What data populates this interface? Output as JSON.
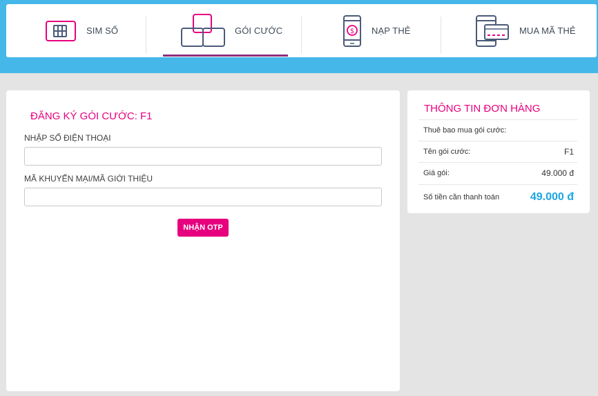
{
  "nav": {
    "items": [
      {
        "label": "SIM SỐ",
        "icon": "sim-card-icon"
      },
      {
        "label": "GÓI CƯỚC",
        "icon": "package-boxes-icon"
      },
      {
        "label": "NẠP THẺ",
        "icon": "phone-topup-icon"
      },
      {
        "label": "MUA MÃ THẺ",
        "icon": "phone-card-icon"
      }
    ],
    "active": "GÓI CƯỚC"
  },
  "form": {
    "title": "ĐĂNG KÝ GÓI CƯỚC: F1",
    "phone_label": "NHẬP SỐ ĐIỆN THOẠI",
    "phone_value": "",
    "promo_label": "MÃ KHUYẾN MẠI/MÃ GIỚI THIỆU",
    "promo_value": "",
    "otp_button": "NHẬN OTP"
  },
  "order": {
    "title": "THÔNG TIN ĐƠN HÀNG",
    "rows": [
      {
        "label": "Thuê bao mua gói cước:",
        "value": ""
      },
      {
        "label": "Tên gói cước:",
        "value": "F1"
      },
      {
        "label": "Giá gói:",
        "value": "49.000 đ"
      },
      {
        "label": "Số tiền cần thanh toán",
        "value": "49.000 đ"
      }
    ]
  },
  "colors": {
    "brand_pink": "#e6007e",
    "header_blue": "#45b7e8",
    "total_blue": "#1aa6e6",
    "active_underline": "#8e2f7c",
    "icon_navy": "#4a5a78"
  }
}
